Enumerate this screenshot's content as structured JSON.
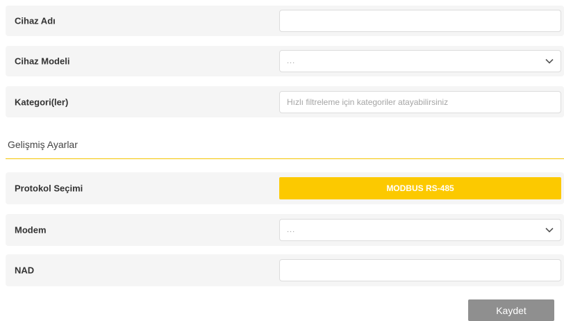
{
  "form": {
    "device_name": {
      "label": "Cihaz Adı",
      "value": ""
    },
    "device_model": {
      "label": "Cihaz Modeli",
      "selected": "..."
    },
    "categories": {
      "label": "Kategori(ler)",
      "placeholder": "Hızlı filtreleme için kategoriler atayabilirsiniz"
    }
  },
  "advanced": {
    "title": "Gelişmiş Ayarlar",
    "protocol": {
      "label": "Protokol Seçimi",
      "button_label": "MODBUS RS-485"
    },
    "modem": {
      "label": "Modem",
      "selected": "..."
    },
    "nad": {
      "label": "NAD",
      "value": ""
    }
  },
  "actions": {
    "save_label": "Kaydet"
  },
  "colors": {
    "accent": "#fcc900",
    "row_background": "#f5f5f5",
    "save_button": "#8f8f8f"
  }
}
